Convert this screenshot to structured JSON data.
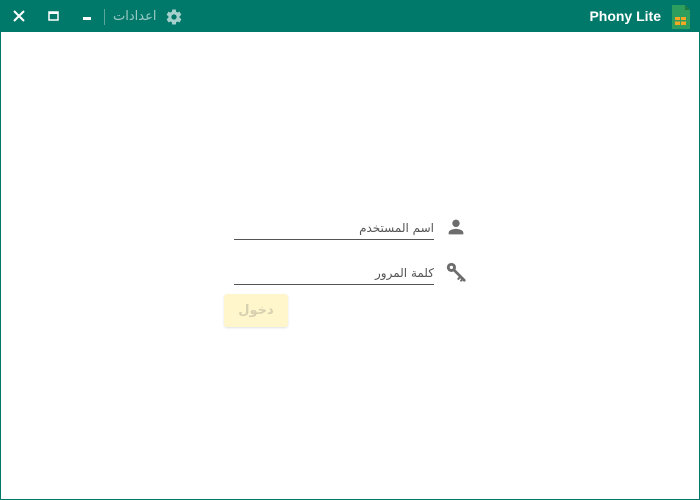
{
  "app": {
    "title": "Phony Lite",
    "accent_color": "#00796b"
  },
  "titlebar": {
    "settings_label": "اعدادات",
    "icons": [
      "close-icon",
      "maximize-icon",
      "minimize-icon",
      "gear-icon",
      "app-logo-icon"
    ]
  },
  "login": {
    "username_placeholder": "اسم المستخدم",
    "password_placeholder": "كلمة المرور",
    "submit_label": "دخول",
    "username_icon": "user-icon",
    "password_icon": "key-icon"
  }
}
